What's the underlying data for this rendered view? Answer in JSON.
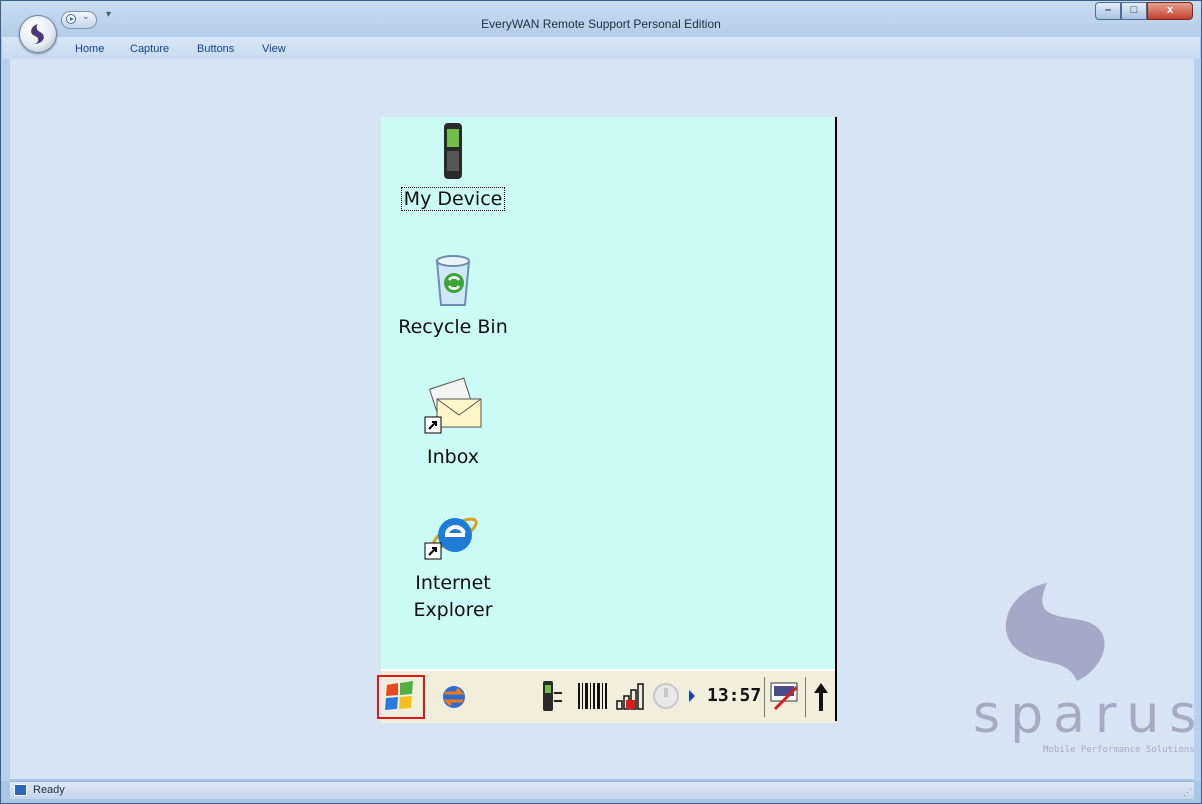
{
  "window": {
    "title": "EveryWAN Remote Support Personal Edition",
    "controls": {
      "minimize": "–",
      "maximize": "□",
      "close": "x"
    }
  },
  "ribbon": {
    "tabs": [
      "Home",
      "Capture",
      "Buttons",
      "View"
    ]
  },
  "device": {
    "desktop_icons": [
      {
        "label_lines": [
          "My Device"
        ],
        "icon": "pda-device-icon",
        "selected": true
      },
      {
        "label_lines": [
          "Recycle Bin"
        ],
        "icon": "recycle-bin-icon",
        "selected": false
      },
      {
        "label_lines": [
          "Inbox"
        ],
        "icon": "inbox-mail-icon",
        "selected": false
      },
      {
        "label_lines": [
          "Internet",
          "Explorer"
        ],
        "icon": "internet-explorer-icon",
        "selected": false
      }
    ],
    "taskbar": {
      "start_icon": "windows-flag-icon",
      "sync_icon": "activesync-icon",
      "tray_icons": [
        "device-sync-icon",
        "barcode-scanner-icon",
        "signal-strength-icon",
        "power-icon"
      ],
      "clock": "13:57",
      "input_icon": "keyboard-input-icon",
      "up_arrow_icon": "up-arrow-icon"
    }
  },
  "logo": {
    "brand": "sparus",
    "tagline": "Mobile Performance Solutions"
  },
  "statusbar": {
    "text": "Ready"
  }
}
